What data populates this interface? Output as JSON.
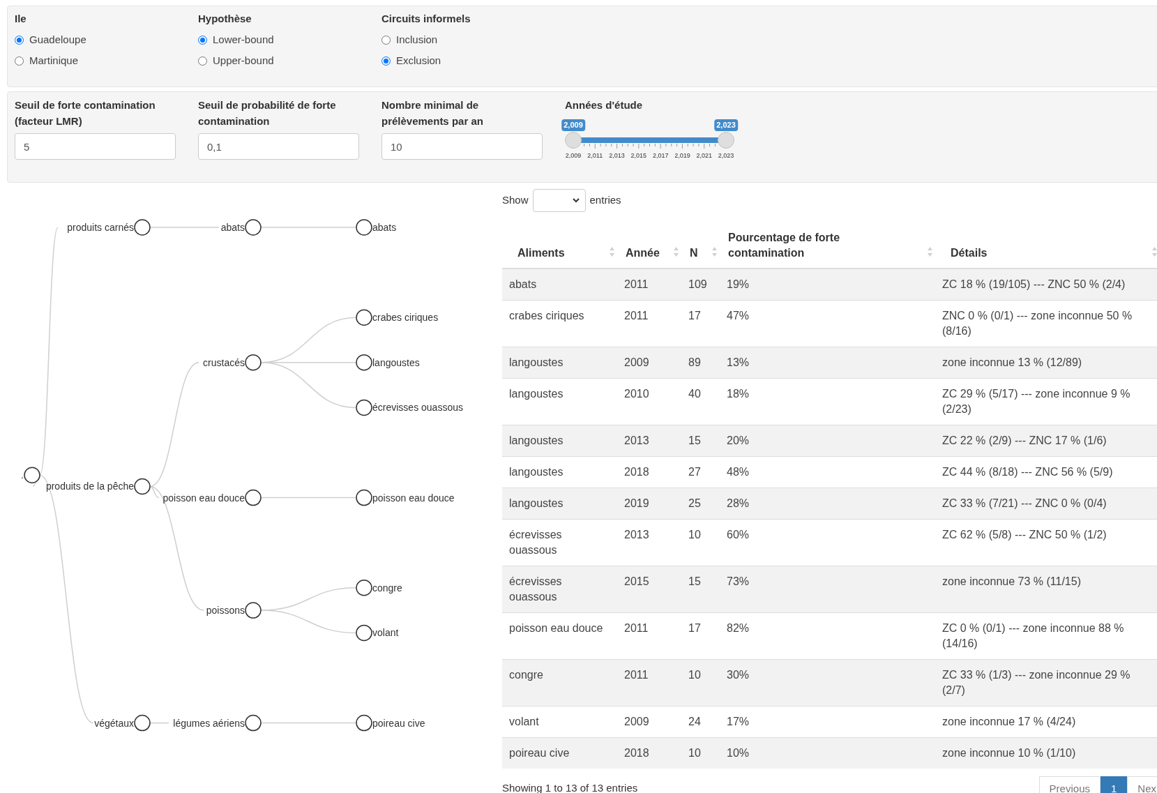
{
  "filters": [
    {
      "label": "Ile",
      "options": [
        {
          "label": "Guadeloupe",
          "selected": true
        },
        {
          "label": "Martinique",
          "selected": false
        }
      ]
    },
    {
      "label": "Hypothèse",
      "options": [
        {
          "label": "Lower-bound",
          "selected": true
        },
        {
          "label": "Upper-bound",
          "selected": false
        }
      ]
    },
    {
      "label": "Circuits informels",
      "options": [
        {
          "label": "Inclusion",
          "selected": false
        },
        {
          "label": "Exclusion",
          "selected": true
        }
      ]
    }
  ],
  "parameters": [
    {
      "label": "Seuil de forte contamination (facteur LMR)",
      "value": "5"
    },
    {
      "label": "Seuil de probabilité de forte contamination",
      "value": "0,1"
    },
    {
      "label": "Nombre minimal de prélèvements par an",
      "value": "10"
    }
  ],
  "year_slider": {
    "label": "Années d'étude",
    "thumbs": [
      {
        "label": "2,009",
        "level": 0
      },
      {
        "label": "2,023",
        "level": 1
      }
    ],
    "ticks": [
      "2,009",
      "2,011",
      "2,013",
      "2,015",
      "2,017",
      "2,019",
      "2,021",
      "2,023"
    ]
  },
  "tree": {
    "label": ".",
    "children": [
      {
        "label": "produits carnés",
        "children": [
          {
            "label": "abats",
            "children": [
              {
                "label": "abats"
              }
            ]
          }
        ]
      },
      {
        "label": "produits de la pêche",
        "children": [
          {
            "label": "crustacés",
            "children": [
              {
                "label": "crabes ciriques"
              },
              {
                "label": "langoustes"
              },
              {
                "label": "écrevisses ouassous"
              }
            ]
          },
          {
            "label": "poisson eau douce",
            "children": [
              {
                "label": "poisson eau douce"
              }
            ]
          },
          {
            "label": "poissons",
            "children": [
              {
                "label": "congre"
              },
              {
                "label": "volant"
              }
            ]
          }
        ]
      },
      {
        "label": "végétaux",
        "children": [
          {
            "label": "légumes aériens",
            "children": [
              {
                "label": "poireau cive"
              }
            ]
          }
        ]
      }
    ]
  },
  "table": {
    "length_menu": {
      "before": "Show",
      "after": "entries"
    },
    "columns": [
      "Aliments",
      "Année",
      "N",
      "Pourcentage de forte contamination",
      "Détails"
    ],
    "rows": [
      [
        "abats",
        "2011",
        "109",
        "19%",
        "ZC 18 % (19/105) --- ZNC 50 % (2/4)"
      ],
      [
        "crabes ciriques",
        "2011",
        "17",
        "47%",
        "ZNC 0 % (0/1) --- zone inconnue 50 % (8/16)"
      ],
      [
        "langoustes",
        "2009",
        "89",
        "13%",
        "zone inconnue 13 % (12/89)"
      ],
      [
        "langoustes",
        "2010",
        "40",
        "18%",
        "ZC 29 % (5/17) --- zone inconnue 9 % (2/23)"
      ],
      [
        "langoustes",
        "2013",
        "15",
        "20%",
        "ZC 22 % (2/9) --- ZNC 17 % (1/6)"
      ],
      [
        "langoustes",
        "2018",
        "27",
        "48%",
        "ZC 44 % (8/18) --- ZNC 56 % (5/9)"
      ],
      [
        "langoustes",
        "2019",
        "25",
        "28%",
        "ZC 33 % (7/21) --- ZNC 0 % (0/4)"
      ],
      [
        "écrevisses ouassous",
        "2013",
        "10",
        "60%",
        "ZC 62 % (5/8) --- ZNC 50 % (1/2)"
      ],
      [
        "écrevisses ouassous",
        "2015",
        "15",
        "73%",
        "zone inconnue 73 % (11/15)"
      ],
      [
        "poisson eau douce",
        "2011",
        "17",
        "82%",
        "ZC 0 % (0/1) --- zone inconnue 88 % (14/16)"
      ],
      [
        "congre",
        "2011",
        "10",
        "30%",
        "ZC 33 % (1/3) --- zone inconnue 29 % (2/7)"
      ],
      [
        "volant",
        "2009",
        "24",
        "17%",
        "zone inconnue 17 % (4/24)"
      ],
      [
        "poireau cive",
        "2018",
        "10",
        "10%",
        "zone inconnue 10 % (1/10)"
      ]
    ],
    "info": "Showing 1 to 13 of 13 entries",
    "pagination": [
      {
        "label": "Previous",
        "selected": false
      },
      {
        "label": "1",
        "selected": true
      },
      {
        "label": "Nex",
        "selected": false
      }
    ]
  }
}
